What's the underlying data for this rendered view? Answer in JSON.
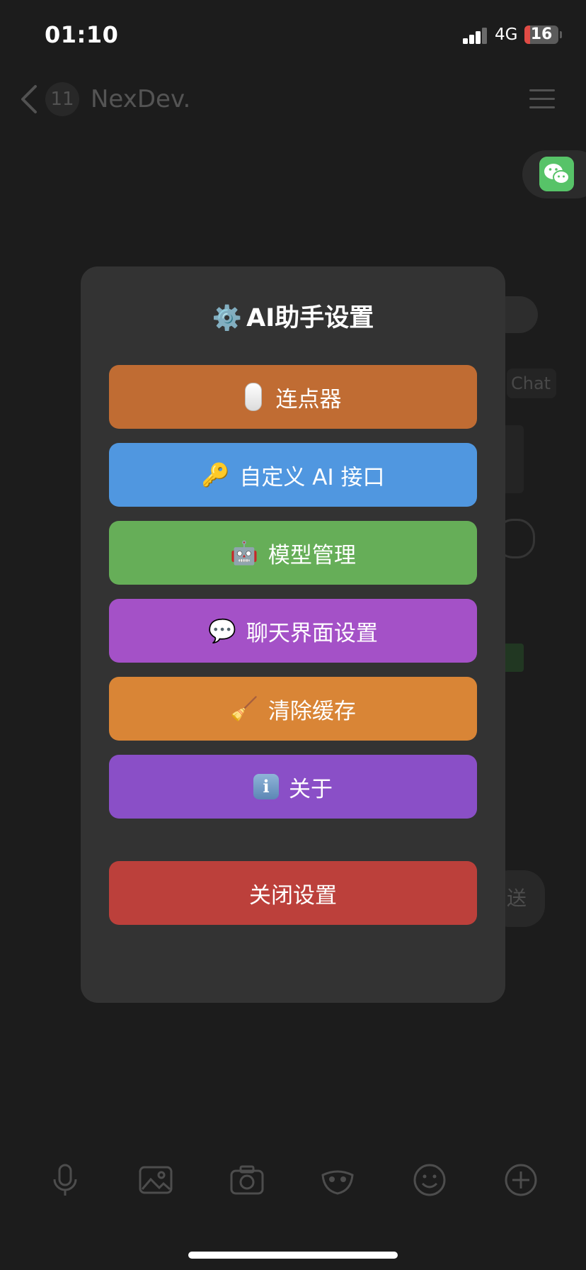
{
  "status_bar": {
    "time": "01:10",
    "network": "4G",
    "battery": "16",
    "battery_level": 0.16
  },
  "chat_header": {
    "unread_count": "11",
    "contact_name": "NexDev."
  },
  "background_snippets": {
    "chat_text": "Chat",
    "send_label": "送"
  },
  "modal": {
    "title": "AI助手设置",
    "title_icon": "⚙️",
    "buttons": [
      {
        "icon": "mouse",
        "label": "连点器",
        "color": "#c06c33"
      },
      {
        "icon": "🔑",
        "label": "自定义 AI 接口",
        "color": "#5097e0"
      },
      {
        "icon": "🤖",
        "label": "模型管理",
        "color": "#66ae58"
      },
      {
        "icon": "💬",
        "label": "聊天界面设置",
        "color": "#a451c7"
      },
      {
        "icon": "🧹",
        "label": "清除缓存",
        "color": "#d98536"
      },
      {
        "icon": "i",
        "label": "关于",
        "color": "#8a4fc7"
      }
    ],
    "close_label": "关闭设置",
    "close_color": "#bc403b"
  }
}
